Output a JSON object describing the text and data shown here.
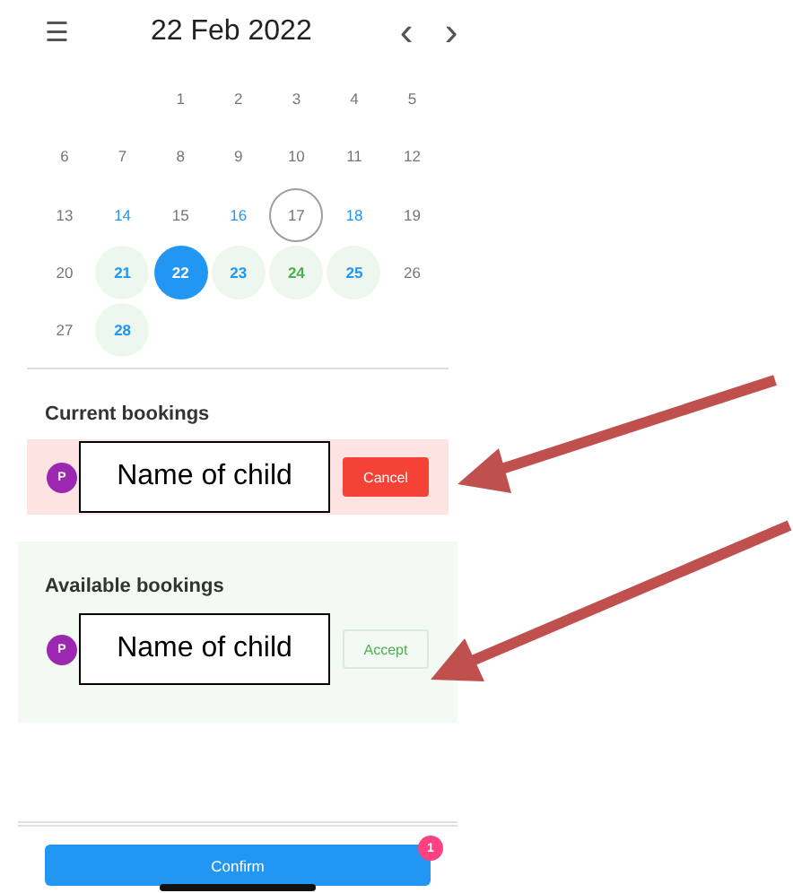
{
  "header": {
    "menu_icon": "☰",
    "title": "22 Feb 2022",
    "prev": "‹",
    "next": "›"
  },
  "weeks": [
    {
      "kind": "trailing",
      "days": [
        {
          "label": "1",
          "color": "#757575",
          "shaded": false,
          "selected": false,
          "today": false
        },
        {
          "label": "2",
          "color": "#757575",
          "shaded": false,
          "selected": false,
          "today": false
        },
        {
          "label": "3",
          "color": "#757575",
          "shaded": false,
          "selected": false,
          "today": false
        },
        {
          "label": "4",
          "color": "#757575",
          "shaded": false,
          "selected": false,
          "today": false
        },
        {
          "label": "5",
          "color": "#757575",
          "shaded": false,
          "selected": false,
          "today": false
        }
      ]
    },
    {
      "kind": "leading",
      "days": [
        {
          "label": "6",
          "color": "#757575",
          "shaded": false,
          "selected": false,
          "today": false
        },
        {
          "label": "7",
          "color": "#757575",
          "shaded": false,
          "selected": false,
          "today": false
        },
        {
          "label": "8",
          "color": "#757575",
          "shaded": false,
          "selected": false,
          "today": false
        },
        {
          "label": "9",
          "color": "#757575",
          "shaded": false,
          "selected": false,
          "today": false
        },
        {
          "label": "10",
          "color": "#757575",
          "shaded": false,
          "selected": false,
          "today": false
        },
        {
          "label": "11",
          "color": "#757575",
          "shaded": false,
          "selected": false,
          "today": false
        },
        {
          "label": "12",
          "color": "#757575",
          "shaded": false,
          "selected": false,
          "today": false
        }
      ]
    },
    {
      "kind": "leading",
      "days": [
        {
          "label": "13",
          "color": "#757575",
          "shaded": false,
          "selected": false,
          "today": false
        },
        {
          "label": "14",
          "color": "#2196f3",
          "shaded": false,
          "selected": false,
          "today": false
        },
        {
          "label": "15",
          "color": "#757575",
          "shaded": false,
          "selected": false,
          "today": false
        },
        {
          "label": "16",
          "color": "#2196f3",
          "shaded": false,
          "selected": false,
          "today": false
        },
        {
          "label": "17",
          "color": "#757575",
          "shaded": false,
          "selected": false,
          "today": true
        },
        {
          "label": "18",
          "color": "#2196f3",
          "shaded": false,
          "selected": false,
          "today": false
        },
        {
          "label": "19",
          "color": "#757575",
          "shaded": false,
          "selected": false,
          "today": false
        }
      ]
    },
    {
      "kind": "leading",
      "days": [
        {
          "label": "20",
          "color": "#757575",
          "shaded": false,
          "selected": false,
          "today": false
        },
        {
          "label": "21",
          "color": "#2196f3",
          "shaded": true,
          "selected": false,
          "today": false
        },
        {
          "label": "22",
          "shaded": false,
          "selected": true,
          "today": false
        },
        {
          "label": "23",
          "color": "#2196f3",
          "shaded": true,
          "selected": false,
          "today": false
        },
        {
          "label": "24",
          "color": "#4caf50",
          "shaded": true,
          "selected": false,
          "today": false
        },
        {
          "label": "25",
          "color": "#2196f3",
          "shaded": true,
          "selected": false,
          "today": false
        },
        {
          "label": "26",
          "color": "#757575",
          "shaded": false,
          "selected": false,
          "today": false
        }
      ]
    },
    {
      "kind": "leading",
      "days": [
        {
          "label": "27",
          "color": "#757575",
          "shaded": false,
          "selected": false,
          "today": false
        },
        {
          "label": "28",
          "color": "#2196f3",
          "shaded": true,
          "selected": false,
          "today": false
        }
      ]
    }
  ],
  "sections": [
    {
      "kind": "current",
      "title": "Current bookings",
      "avatar": "P",
      "name": "Name of child",
      "action": "Cancel"
    },
    {
      "kind": "available",
      "title": "Available bookings",
      "avatar": "P",
      "name": "Name of child",
      "action": "Accept"
    }
  ],
  "confirm": {
    "label": "Confirm",
    "badge": "1"
  }
}
